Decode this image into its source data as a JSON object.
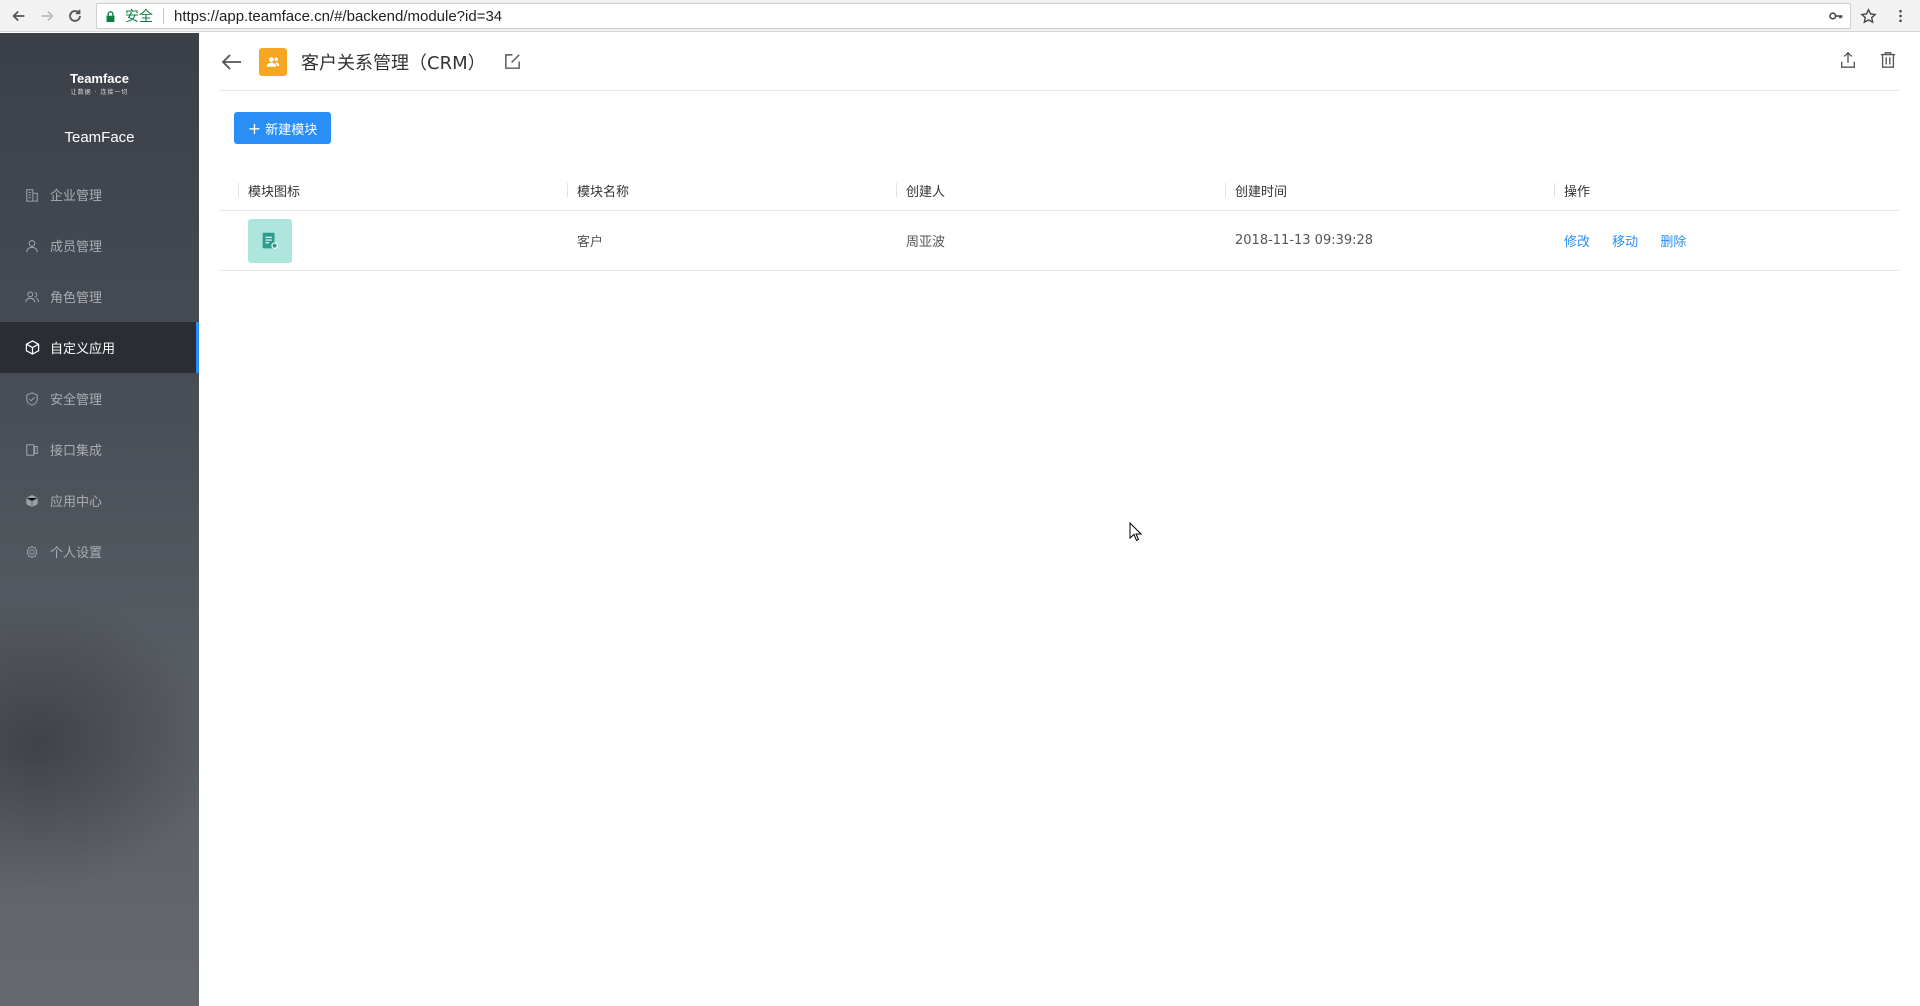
{
  "browser": {
    "secure_label": "安全",
    "url": "https://app.teamface.cn/#/backend/module?id=34"
  },
  "sidebar": {
    "logo_text": "Teamface",
    "logo_tagline": "让数据 · 连接一切",
    "company_name": "TeamFace",
    "items": [
      {
        "label": "企业管理",
        "icon": "building-icon",
        "active": false
      },
      {
        "label": "成员管理",
        "icon": "user-icon",
        "active": false
      },
      {
        "label": "角色管理",
        "icon": "role-icon",
        "active": false
      },
      {
        "label": "自定义应用",
        "icon": "cube-icon",
        "active": true
      },
      {
        "label": "安全管理",
        "icon": "shield-icon",
        "active": false
      },
      {
        "label": "接口集成",
        "icon": "plug-icon",
        "active": false
      },
      {
        "label": "应用中心",
        "icon": "apps-icon",
        "active": false
      },
      {
        "label": "个人设置",
        "icon": "gear-icon",
        "active": false
      }
    ]
  },
  "header": {
    "title": "客户关系管理（CRM）"
  },
  "toolbar": {
    "new_module_label": "新建模块"
  },
  "table": {
    "columns": [
      "模块图标",
      "模块名称",
      "创建人",
      "创建时间",
      "操作"
    ],
    "rows": [
      {
        "name": "客户",
        "creator": "周亚波",
        "created_at": "2018-11-13 09:39:28",
        "actions": [
          "修改",
          "移动",
          "删除"
        ]
      }
    ]
  },
  "colors": {
    "accent": "#2a8ef7",
    "app_icon": "#f5a623",
    "module_icon_bg": "#aee6dd",
    "sidebar_bg": "#3b4048"
  }
}
